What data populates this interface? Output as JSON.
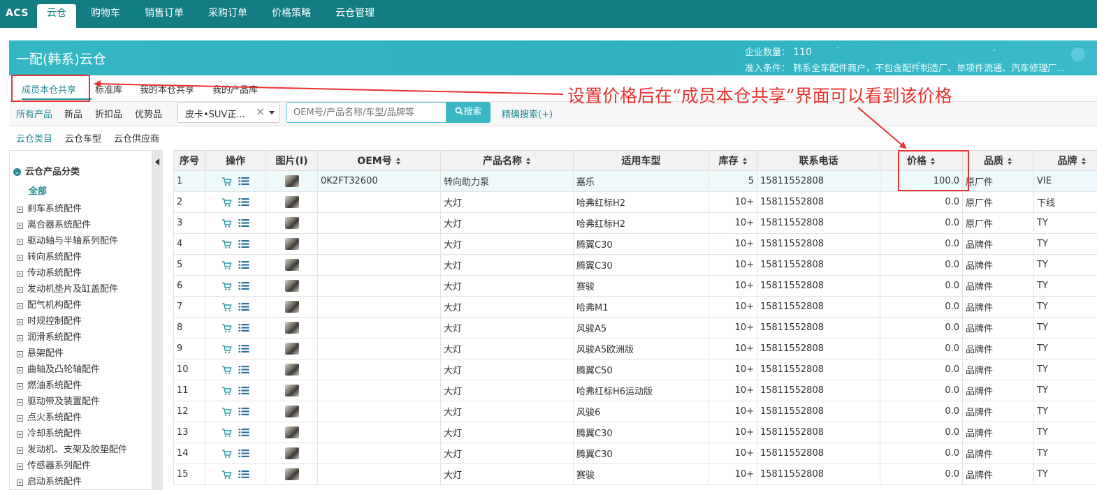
{
  "topnav": {
    "brand": "ACS",
    "tabs": [
      {
        "label": "云仓",
        "active": true
      },
      {
        "label": "购物车"
      },
      {
        "label": "销售订单"
      },
      {
        "label": "采购订单"
      },
      {
        "label": "价格策略"
      },
      {
        "label": "云仓管理"
      }
    ]
  },
  "banner": {
    "title": "一配(韩系)云仓",
    "enterprise_count_label": "企业数量：",
    "enterprise_count": "110",
    "criteria_label": "准入条件：",
    "criteria_text": "韩系全车配件商户，不包含配件制造厂、单项件流通、汽车修理厂..."
  },
  "subtabs": [
    {
      "label": "成员本仓共享",
      "active": true
    },
    {
      "label": "标准库"
    },
    {
      "label": "我的本仓共享"
    },
    {
      "label": "我的产品库"
    }
  ],
  "annotation": "设置价格后在“成员本仓共享”界面可以看到该价格",
  "filters": {
    "quick": [
      "所有产品",
      "新品",
      "折扣品",
      "优势品"
    ],
    "select_value": "皮卡•SUV正...",
    "search_placeholder": "OEM号/产品名称/车型/品牌等",
    "search_button": "搜索",
    "advanced": "精确搜索(+)"
  },
  "catbar": [
    "云仓类目",
    "云仓车型",
    "云仓供应商"
  ],
  "sidebar": {
    "title": "云仓产品分类",
    "all": "全部",
    "items": [
      "刹车系统配件",
      "离合器系统配件",
      "驱动轴与半轴系列配件",
      "转向系统配件",
      "传动系统配件",
      "发动机垫片及缸盖配件",
      "配气机构配件",
      "时规控制配件",
      "润滑系统配件",
      "悬架配件",
      "曲轴及凸轮轴配件",
      "燃油系统配件",
      "驱动带及装置配件",
      "点火系统配件",
      "冷却系统配件",
      "发动机、支架及胶垫配件",
      "传感器系列配件",
      "启动系统配件"
    ]
  },
  "table": {
    "headers": [
      "序号",
      "操作",
      "图片(I)",
      "OEM号",
      "产品名称",
      "适用车型",
      "库存",
      "联系电话",
      "价格",
      "品质",
      "品牌"
    ],
    "rows": [
      [
        "1",
        "0K2FT32600",
        "转向助力泵",
        "嘉乐",
        "5",
        "15811552808",
        "100.0",
        "原厂件",
        "VIE"
      ],
      [
        "2",
        "",
        "大灯",
        "哈弗红标H2",
        "10+",
        "15811552808",
        "0.0",
        "原厂件",
        "下线"
      ],
      [
        "3",
        "",
        "大灯",
        "哈弗红标H2",
        "10+",
        "15811552808",
        "0.0",
        "原厂件",
        "TY"
      ],
      [
        "4",
        "",
        "大灯",
        "腾翼C30",
        "10+",
        "15811552808",
        "0.0",
        "品牌件",
        "TY"
      ],
      [
        "5",
        "",
        "大灯",
        "腾翼C30",
        "10+",
        "15811552808",
        "0.0",
        "品牌件",
        "TY"
      ],
      [
        "6",
        "",
        "大灯",
        "赛骏",
        "10+",
        "15811552808",
        "0.0",
        "品牌件",
        "TY"
      ],
      [
        "7",
        "",
        "大灯",
        "哈弗M1",
        "10+",
        "15811552808",
        "0.0",
        "品牌件",
        "TY"
      ],
      [
        "8",
        "",
        "大灯",
        "风骏A5",
        "10+",
        "15811552808",
        "0.0",
        "品牌件",
        "TY"
      ],
      [
        "9",
        "",
        "大灯",
        "风骏A5欧洲版",
        "10+",
        "15811552808",
        "0.0",
        "品牌件",
        "TY"
      ],
      [
        "10",
        "",
        "大灯",
        "腾翼C50",
        "10+",
        "15811552808",
        "0.0",
        "品牌件",
        "TY"
      ],
      [
        "11",
        "",
        "大灯",
        "哈弗红标H6运动版",
        "10+",
        "15811552808",
        "0.0",
        "品牌件",
        "TY"
      ],
      [
        "12",
        "",
        "大灯",
        "风骏6",
        "10+",
        "15811552808",
        "0.0",
        "品牌件",
        "TY"
      ],
      [
        "13",
        "",
        "大灯",
        "腾翼C30",
        "10+",
        "15811552808",
        "0.0",
        "品牌件",
        "TY"
      ],
      [
        "14",
        "",
        "大灯",
        "腾翼C30",
        "10+",
        "15811552808",
        "0.0",
        "品牌件",
        "TY"
      ],
      [
        "15",
        "",
        "大灯",
        "赛骏",
        "10+",
        "15811552808",
        "0.0",
        "品牌件",
        "TY"
      ]
    ]
  },
  "colors": {
    "primary": "#127d82",
    "banner": "#34b6c4",
    "highlight": "#e8322f"
  }
}
